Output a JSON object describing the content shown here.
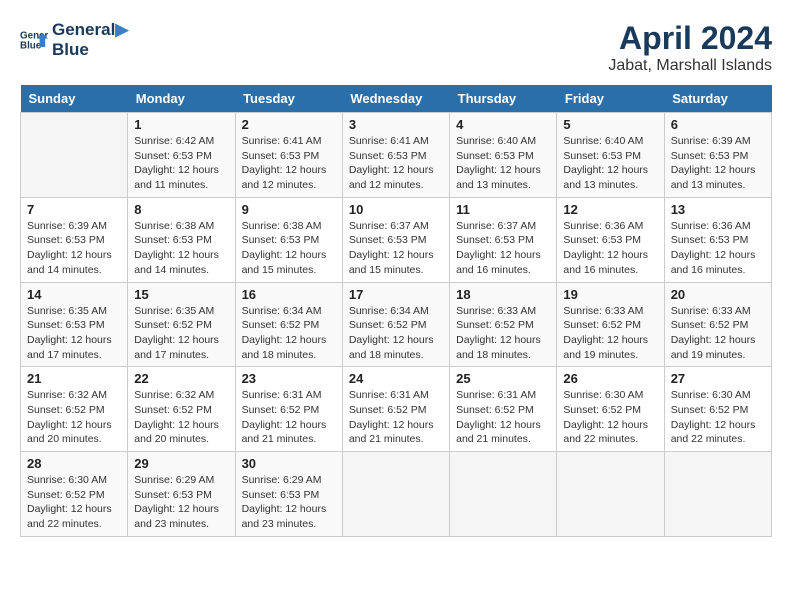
{
  "header": {
    "logo_line1": "General",
    "logo_line2": "Blue",
    "month_year": "April 2024",
    "location": "Jabat, Marshall Islands"
  },
  "calendar": {
    "days_of_week": [
      "Sunday",
      "Monday",
      "Tuesday",
      "Wednesday",
      "Thursday",
      "Friday",
      "Saturday"
    ],
    "weeks": [
      [
        {
          "day": "",
          "sunrise": "",
          "sunset": "",
          "daylight": ""
        },
        {
          "day": "1",
          "sunrise": "6:42 AM",
          "sunset": "6:53 PM",
          "daylight": "12 hours and 11 minutes."
        },
        {
          "day": "2",
          "sunrise": "6:41 AM",
          "sunset": "6:53 PM",
          "daylight": "12 hours and 12 minutes."
        },
        {
          "day": "3",
          "sunrise": "6:41 AM",
          "sunset": "6:53 PM",
          "daylight": "12 hours and 12 minutes."
        },
        {
          "day": "4",
          "sunrise": "6:40 AM",
          "sunset": "6:53 PM",
          "daylight": "12 hours and 13 minutes."
        },
        {
          "day": "5",
          "sunrise": "6:40 AM",
          "sunset": "6:53 PM",
          "daylight": "12 hours and 13 minutes."
        },
        {
          "day": "6",
          "sunrise": "6:39 AM",
          "sunset": "6:53 PM",
          "daylight": "12 hours and 13 minutes."
        }
      ],
      [
        {
          "day": "7",
          "sunrise": "6:39 AM",
          "sunset": "6:53 PM",
          "daylight": "12 hours and 14 minutes."
        },
        {
          "day": "8",
          "sunrise": "6:38 AM",
          "sunset": "6:53 PM",
          "daylight": "12 hours and 14 minutes."
        },
        {
          "day": "9",
          "sunrise": "6:38 AM",
          "sunset": "6:53 PM",
          "daylight": "12 hours and 15 minutes."
        },
        {
          "day": "10",
          "sunrise": "6:37 AM",
          "sunset": "6:53 PM",
          "daylight": "12 hours and 15 minutes."
        },
        {
          "day": "11",
          "sunrise": "6:37 AM",
          "sunset": "6:53 PM",
          "daylight": "12 hours and 16 minutes."
        },
        {
          "day": "12",
          "sunrise": "6:36 AM",
          "sunset": "6:53 PM",
          "daylight": "12 hours and 16 minutes."
        },
        {
          "day": "13",
          "sunrise": "6:36 AM",
          "sunset": "6:53 PM",
          "daylight": "12 hours and 16 minutes."
        }
      ],
      [
        {
          "day": "14",
          "sunrise": "6:35 AM",
          "sunset": "6:53 PM",
          "daylight": "12 hours and 17 minutes."
        },
        {
          "day": "15",
          "sunrise": "6:35 AM",
          "sunset": "6:52 PM",
          "daylight": "12 hours and 17 minutes."
        },
        {
          "day": "16",
          "sunrise": "6:34 AM",
          "sunset": "6:52 PM",
          "daylight": "12 hours and 18 minutes."
        },
        {
          "day": "17",
          "sunrise": "6:34 AM",
          "sunset": "6:52 PM",
          "daylight": "12 hours and 18 minutes."
        },
        {
          "day": "18",
          "sunrise": "6:33 AM",
          "sunset": "6:52 PM",
          "daylight": "12 hours and 18 minutes."
        },
        {
          "day": "19",
          "sunrise": "6:33 AM",
          "sunset": "6:52 PM",
          "daylight": "12 hours and 19 minutes."
        },
        {
          "day": "20",
          "sunrise": "6:33 AM",
          "sunset": "6:52 PM",
          "daylight": "12 hours and 19 minutes."
        }
      ],
      [
        {
          "day": "21",
          "sunrise": "6:32 AM",
          "sunset": "6:52 PM",
          "daylight": "12 hours and 20 minutes."
        },
        {
          "day": "22",
          "sunrise": "6:32 AM",
          "sunset": "6:52 PM",
          "daylight": "12 hours and 20 minutes."
        },
        {
          "day": "23",
          "sunrise": "6:31 AM",
          "sunset": "6:52 PM",
          "daylight": "12 hours and 21 minutes."
        },
        {
          "day": "24",
          "sunrise": "6:31 AM",
          "sunset": "6:52 PM",
          "daylight": "12 hours and 21 minutes."
        },
        {
          "day": "25",
          "sunrise": "6:31 AM",
          "sunset": "6:52 PM",
          "daylight": "12 hours and 21 minutes."
        },
        {
          "day": "26",
          "sunrise": "6:30 AM",
          "sunset": "6:52 PM",
          "daylight": "12 hours and 22 minutes."
        },
        {
          "day": "27",
          "sunrise": "6:30 AM",
          "sunset": "6:52 PM",
          "daylight": "12 hours and 22 minutes."
        }
      ],
      [
        {
          "day": "28",
          "sunrise": "6:30 AM",
          "sunset": "6:52 PM",
          "daylight": "12 hours and 22 minutes."
        },
        {
          "day": "29",
          "sunrise": "6:29 AM",
          "sunset": "6:53 PM",
          "daylight": "12 hours and 23 minutes."
        },
        {
          "day": "30",
          "sunrise": "6:29 AM",
          "sunset": "6:53 PM",
          "daylight": "12 hours and 23 minutes."
        },
        {
          "day": "",
          "sunrise": "",
          "sunset": "",
          "daylight": ""
        },
        {
          "day": "",
          "sunrise": "",
          "sunset": "",
          "daylight": ""
        },
        {
          "day": "",
          "sunrise": "",
          "sunset": "",
          "daylight": ""
        },
        {
          "day": "",
          "sunrise": "",
          "sunset": "",
          "daylight": ""
        }
      ]
    ]
  }
}
